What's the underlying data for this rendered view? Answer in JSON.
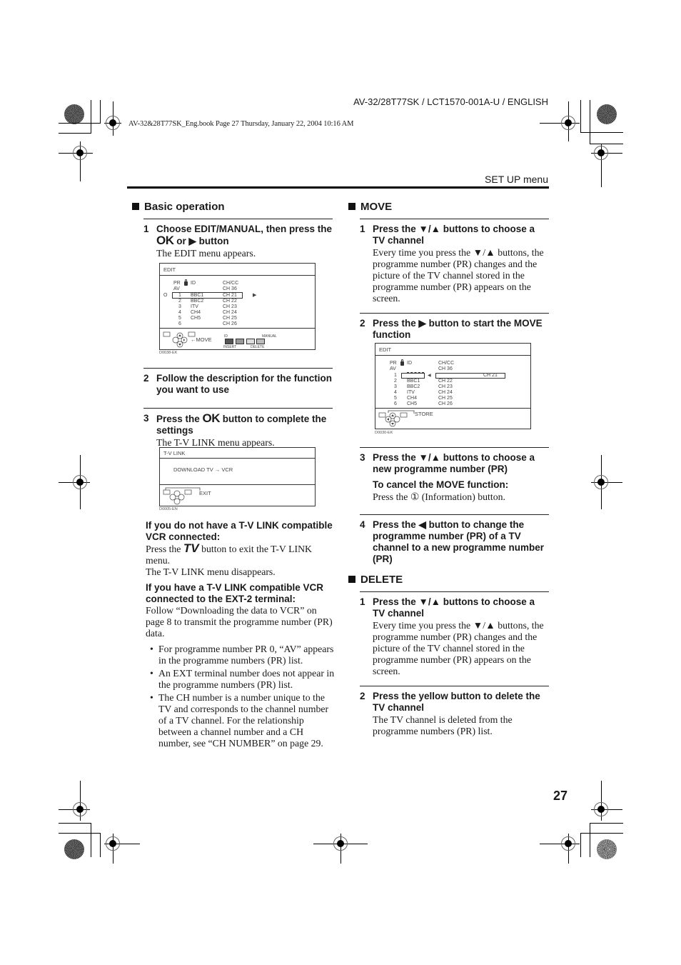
{
  "header": {
    "doc_id": "AV-32/28T77SK / LCT1570-001A-U / ENGLISH",
    "book_line": "AV-32&28T77SK_Eng.book  Page 27  Thursday, January 22, 2004  10:16 AM",
    "section_label": "SET UP menu"
  },
  "left_column": {
    "section_title": "Basic operation",
    "steps": [
      {
        "number": "1",
        "title_pre": "Choose EDIT/MANUAL, then press the ",
        "title_ok": "OK",
        "title_mid": " or ",
        "title_arrow": "▶",
        "title_post": " button",
        "body": "The EDIT menu appears."
      },
      {
        "number": "2",
        "title": "Follow the description for the function you want to use"
      },
      {
        "number": "3",
        "title_pre": "Press the ",
        "title_ok": "OK",
        "title_post": " button to complete the settings",
        "body": "The T-V LINK menu appears."
      }
    ],
    "no_tvlink": {
      "heading": "If you do not have a T-V LINK compatible VCR connected:",
      "body_pre": "Press the ",
      "body_tv": "TV",
      "body_post": " button to exit the T-V LINK menu.",
      "body2": "The T-V LINK menu disappears."
    },
    "has_tvlink": {
      "heading": "If you have a T-V LINK compatible VCR connected to the EXT-2 terminal:",
      "body": "Follow “Downloading the data to VCR” on page 8 to transmit the programme number (PR) data.",
      "bullets": [
        "For programme number PR 0, “AV” appears in the programme numbers (PR) list.",
        "An EXT terminal number does not appear in the programme numbers (PR) list.",
        "The CH number is a number unique to the TV and corresponds to the channel number of a TV channel. For the relationship between a channel number and a CH number, see “CH NUMBER” on page 29."
      ]
    }
  },
  "osd_edit_1": {
    "title": "EDIT",
    "col_pr": "PR",
    "col_id": "ID",
    "col_chcc": "CH/CC",
    "rows": [
      {
        "pr": "AV",
        "id": "",
        "ch": "CH  36"
      },
      {
        "pr": "1",
        "id": "BBC1",
        "ch": "CH  21"
      },
      {
        "pr": "2",
        "id": "BBC2",
        "ch": "CH  22"
      },
      {
        "pr": "3",
        "id": "ITV",
        "ch": "CH  23"
      },
      {
        "pr": "4",
        "id": "CH4",
        "ch": "CH  24"
      },
      {
        "pr": "5",
        "id": "CH5",
        "ch": "CH  25"
      },
      {
        "pr": "6",
        "id": "",
        "ch": "CH  26"
      }
    ],
    "selected_marker": "O",
    "right_arrow": "▶",
    "foot_tv": "TV",
    "foot_ok": "OK",
    "foot_move": "MOVE",
    "key_id": "ID",
    "key_insert": "INSERT",
    "key_delete": "DELETE",
    "key_manual": "MANUAL",
    "key_colors": [
      "#555555",
      "#999999",
      "#dddddd",
      "#bbbbbb"
    ],
    "code": "D0038-EK"
  },
  "osd_tvlink": {
    "title": "T-V LINK",
    "text": "DOWNLOAD TV",
    "arrow": "→",
    "text2": "VCR",
    "foot_tv": "TV",
    "foot_ok": "OK",
    "foot_exit": "EXIT",
    "code": "D0005-EN"
  },
  "right_column": {
    "move": {
      "section_title": "MOVE",
      "steps": [
        {
          "number": "1",
          "title": "Press the ▼/▲ buttons to choose a TV channel",
          "body": "Every time you press the ▼/▲ buttons, the programme number (PR) changes and the picture of the TV channel stored in the programme number (PR) appears on the screen."
        },
        {
          "number": "2",
          "title": "Press the ▶ button to start the MOVE function"
        },
        {
          "number": "3",
          "title": "Press the ▼/▲ buttons to choose a new programme number (PR)",
          "sub_heading": "To cancel the MOVE function:",
          "sub_body_pre": "Press the ",
          "sub_body_icon": "①",
          "sub_body_post": " (Information) button."
        },
        {
          "number": "4",
          "title": "Press the ◀ button to change the programme number (PR) of a TV channel to a new programme number (PR)"
        }
      ]
    },
    "delete": {
      "section_title": "DELETE",
      "steps": [
        {
          "number": "1",
          "title": "Press the ▼/▲ buttons to choose a TV channel",
          "body": "Every time you press the ▼/▲ buttons, the programme number (PR) changes and the picture of the TV channel stored in the programme number (PR) appears on the screen."
        },
        {
          "number": "2",
          "title": "Press the yellow button to delete the TV channel",
          "body": "The TV channel is deleted from the programme numbers (PR) list."
        }
      ]
    }
  },
  "osd_edit_2": {
    "title": "EDIT",
    "col_pr": "PR",
    "col_id": "ID",
    "col_chcc": "CH/CC",
    "rows": [
      {
        "pr": "AV",
        "id": "",
        "ch": "CH  36"
      },
      {
        "pr": "1",
        "id": "",
        "ch": ""
      },
      {
        "pr": "2",
        "id": "BBC1",
        "ch": "CH  22"
      },
      {
        "pr": "3",
        "id": "BBC2",
        "ch": "CH  23"
      },
      {
        "pr": "4",
        "id": "ITV",
        "ch": "CH  24"
      },
      {
        "pr": "5",
        "id": "CH4",
        "ch": "CH  25"
      },
      {
        "pr": "6",
        "id": "CH5",
        "ch": "CH  26"
      }
    ],
    "moving_ch": "CH  21",
    "left_arrow": "◀",
    "foot_tv": "TV",
    "foot_ok": "OK",
    "foot_store": "STORE",
    "code": "D0030-EK"
  },
  "page_number": "27"
}
